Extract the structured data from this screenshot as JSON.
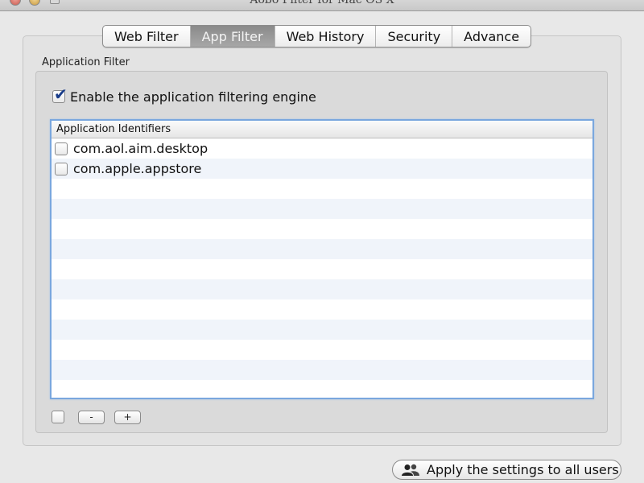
{
  "window": {
    "title": "Aobo Filter for Mac OS X"
  },
  "tabs": [
    {
      "label": "Web Filter",
      "active": false
    },
    {
      "label": "App Filter",
      "active": true
    },
    {
      "label": "Web History",
      "active": false
    },
    {
      "label": "Security",
      "active": false
    },
    {
      "label": "Advance",
      "active": false
    }
  ],
  "app_filter": {
    "section_label": "Application Filter",
    "enable_label": "Enable the application filtering engine",
    "enable_checked": true,
    "list_header": "Application Identifiers",
    "items": [
      {
        "label": "com.aol.aim.desktop",
        "checked": false
      },
      {
        "label": "com.apple.appstore",
        "checked": false
      }
    ],
    "remove_label": "-",
    "add_label": "+"
  },
  "footer": {
    "apply_label": "Apply the settings to all users",
    "apply_icon": "users-icon"
  },
  "colors": {
    "selected_tab": "#9a9a9a",
    "list_focus_border": "#7aa7de",
    "check_mark": "#1a3d8a"
  }
}
